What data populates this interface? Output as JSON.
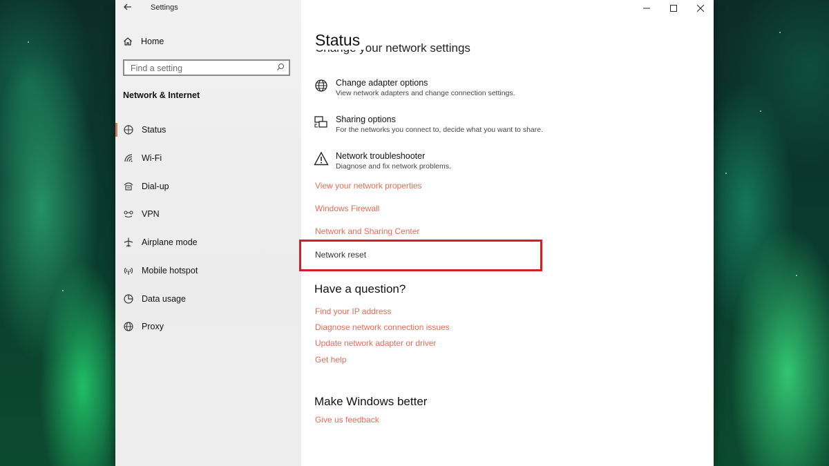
{
  "window": {
    "app_title": "Settings"
  },
  "sidebar": {
    "home_label": "Home",
    "search_placeholder": "Find a setting",
    "section_title": "Network & Internet",
    "items": [
      {
        "label": "Status",
        "icon": "status-icon",
        "active": true
      },
      {
        "label": "Wi-Fi",
        "icon": "wifi-icon"
      },
      {
        "label": "Dial-up",
        "icon": "dialup-icon"
      },
      {
        "label": "VPN",
        "icon": "vpn-icon"
      },
      {
        "label": "Airplane mode",
        "icon": "airplane-icon"
      },
      {
        "label": "Mobile hotspot",
        "icon": "hotspot-icon"
      },
      {
        "label": "Data usage",
        "icon": "data-usage-icon"
      },
      {
        "label": "Proxy",
        "icon": "globe-icon"
      }
    ]
  },
  "main": {
    "page_title": "Status",
    "section_heading": "Change your network settings",
    "options": [
      {
        "title": "Change adapter options",
        "desc": "View network adapters and change connection settings.",
        "icon": "adapter-icon"
      },
      {
        "title": "Sharing options",
        "desc": "For the networks you connect to, decide what you want to share.",
        "icon": "sharing-icon"
      },
      {
        "title": "Network troubleshooter",
        "desc": "Diagnose and fix network problems.",
        "icon": "warning-icon"
      }
    ],
    "links": [
      "View your network properties",
      "Windows Firewall",
      "Network and Sharing Center"
    ],
    "network_reset": "Network reset",
    "question_heading": "Have a question?",
    "question_links": [
      "Find your IP address",
      "Diagnose network connection issues",
      "Update network adapter or driver",
      "Get help"
    ],
    "better_heading": "Make Windows better",
    "feedback_link": "Give us feedback"
  },
  "colors": {
    "accent_link": "#e86a58",
    "highlight": "#d41e25",
    "active_bar": "#e07a5f"
  }
}
